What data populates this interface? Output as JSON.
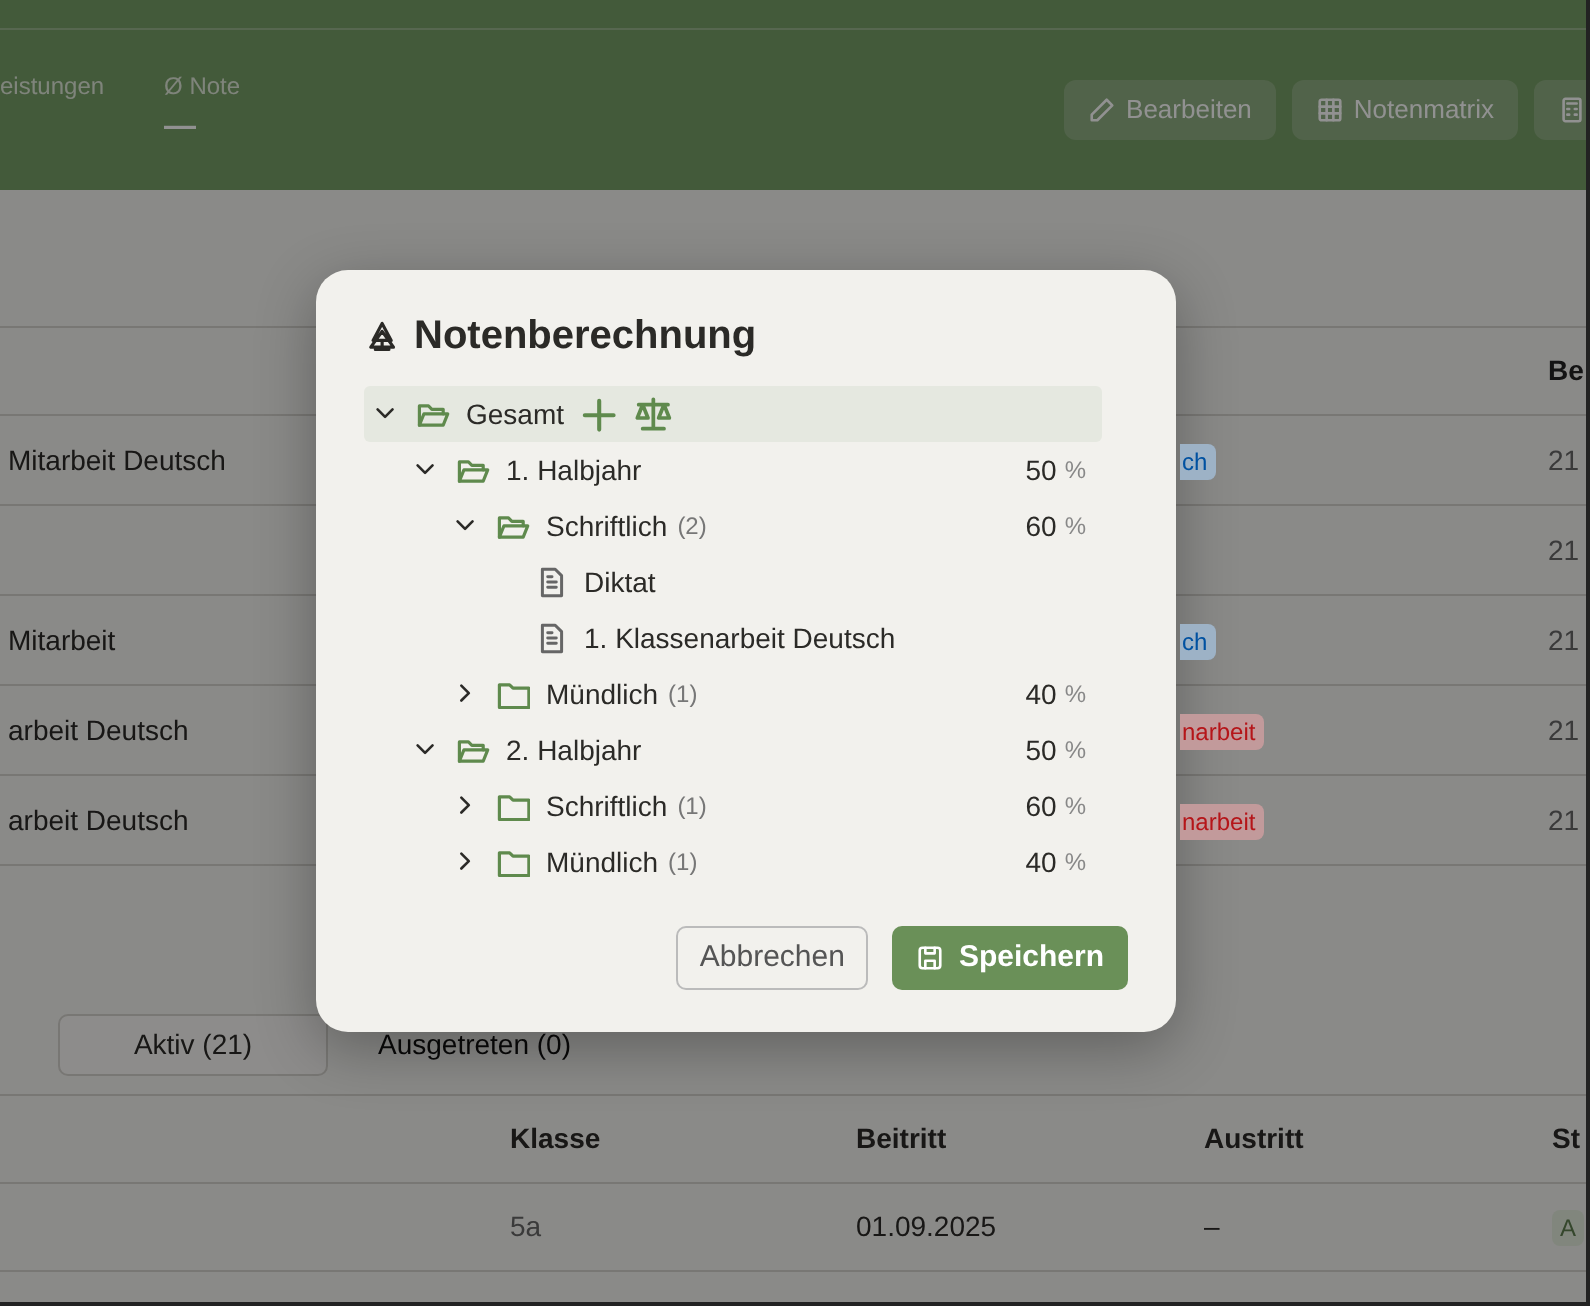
{
  "header": {
    "stats": [
      {
        "label": "eistungen"
      },
      {
        "label": "Ø Note",
        "value": "—"
      }
    ],
    "buttons": [
      {
        "label": "Bearbeiten"
      },
      {
        "label": "Notenmatrix"
      },
      {
        "kind": "icon"
      }
    ]
  },
  "table": {
    "columns": [
      "",
      "",
      "Be"
    ],
    "rows": [
      {
        "title": "Mitarbeit Deutsch",
        "tag": "ch",
        "color": "#9db2c6",
        "cell": "21"
      },
      {
        "cell": "21"
      },
      {
        "title": "Mitarbeit",
        "tag": "ch",
        "color": "#9db2c6",
        "cell": "21"
      },
      {
        "title": "arbeit Deutsch",
        "tag": "narbeit",
        "color": "#c29a9b",
        "cell": "21"
      },
      {
        "title": "arbeit Deutsch",
        "tag": "narbeit",
        "color": "#c29a9b",
        "cell": "21"
      }
    ]
  },
  "member_tabs": [
    {
      "label": "Aktiv (21)",
      "selected": true
    },
    {
      "label": "Ausgetreten (0)",
      "selected": false
    }
  ],
  "members": {
    "columns": [
      "Klasse",
      "Beitritt",
      "Austritt",
      "St"
    ],
    "rows": [
      {
        "cells": [
          "5a",
          "01.09.2025",
          "–"
        ],
        "status": "A"
      }
    ]
  },
  "dialog": {
    "title": "Notenberechnung",
    "tree": [
      {
        "kind": "folder",
        "label": "Gesamt",
        "expanded": true,
        "selected": true,
        "children": [
          {
            "kind": "folder",
            "label": "1. Halbjahr",
            "expanded": true,
            "selected": false,
            "weight": "50",
            "unit": "%",
            "children": [
              {
                "kind": "folder",
                "label": "Schriftlich",
                "count": "(2)",
                "expanded": true,
                "selected": false,
                "weight": "60",
                "unit": "%",
                "children": [
                  {
                    "kind": "file",
                    "label": "Diktat",
                    "selected": false
                  },
                  {
                    "kind": "file",
                    "label": "1. Klassenarbeit Deutsch",
                    "selected": false
                  }
                ]
              },
              {
                "kind": "folder",
                "label": "Mündlich",
                "count": "(1)",
                "expanded": false,
                "selected": false,
                "weight": "40",
                "unit": "%"
              }
            ]
          },
          {
            "kind": "folder",
            "label": "2. Halbjahr",
            "expanded": true,
            "selected": false,
            "weight": "50",
            "unit": "%",
            "children": [
              {
                "kind": "folder",
                "label": "Schriftlich",
                "count": "(1)",
                "expanded": false,
                "selected": false,
                "weight": "60",
                "unit": "%"
              },
              {
                "kind": "folder",
                "label": "Mündlich",
                "count": "(1)",
                "expanded": false,
                "selected": false,
                "weight": "40",
                "unit": "%"
              }
            ]
          }
        ]
      }
    ],
    "buttons": [
      {
        "label": "Abbrechen",
        "kind": "secondary"
      },
      {
        "label": "Speichern",
        "kind": "primary"
      }
    ]
  }
}
